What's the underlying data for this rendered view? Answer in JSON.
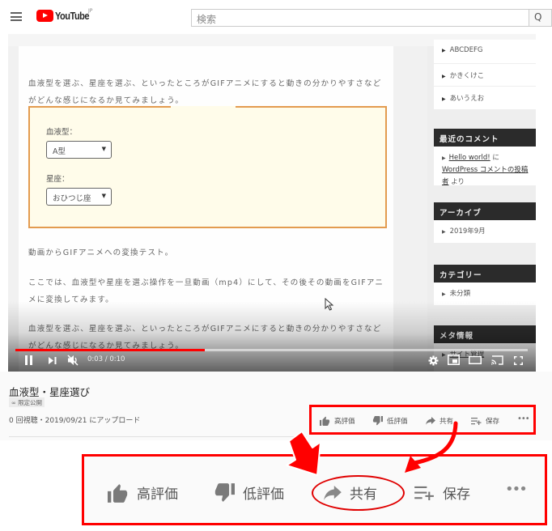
{
  "topbar": {
    "brand": "YouTube",
    "region": "JP",
    "search_placeholder": "検索",
    "search_button_glyph": "Q"
  },
  "video": {
    "article": {
      "para1": "血液型を選ぶ、星座を選ぶ、といったところがGIFアニメにすると動きの分かりやすさなどがどんな感じになるか見てみましょう。",
      "form": {
        "blood_label": "血液型：",
        "blood_value": "A型",
        "sign_label": "星座：",
        "sign_value": "おひつじ座",
        "caret": "▼"
      },
      "para2": "動画からGIFアニメへの変換テスト。",
      "para3": "ここでは、血液型や星座を選ぶ操作を一旦動画（mp4）にして、その後その動画をGIFアニメに変換してみます。",
      "para4": "血液型を選ぶ、星座を選ぶ、といったところがGIFアニメにすると動きの分かりやすさなどがどんな感じになるか見てみましょう。"
    },
    "sidebar": {
      "list_items": [
        "ABCDEFG",
        "かきくけこ",
        "あいうえお"
      ],
      "recent_comments_title": "最近のコメント",
      "recent_comment": {
        "post_link": "Hello world!",
        "joiner": " に ",
        "author_link": "WordPress コメントの投稿者",
        "suffix": " より"
      },
      "archive_title": "アーカイブ",
      "archive_item": "2019年9月",
      "category_title": "カテゴリー",
      "category_item": "未分類",
      "meta_title": "メタ情報",
      "meta_item": "サイト管理"
    },
    "player": {
      "progress_fraction": 0.37,
      "current_time": "0:03",
      "duration": "0:10",
      "time_display": "0:03 / 0:10",
      "muted": true,
      "playing": true
    }
  },
  "info": {
    "title": "血液型・星座選び",
    "visibility_badge": "限定公開",
    "meta": "0 回視聴・2019/09/21 にアップロード"
  },
  "actions": {
    "like": "高評価",
    "dislike": "低評価",
    "share": "共有",
    "save": "保存",
    "more": "•••"
  },
  "annotation": {
    "color": "#ff0000",
    "highlighted_action": "share"
  }
}
